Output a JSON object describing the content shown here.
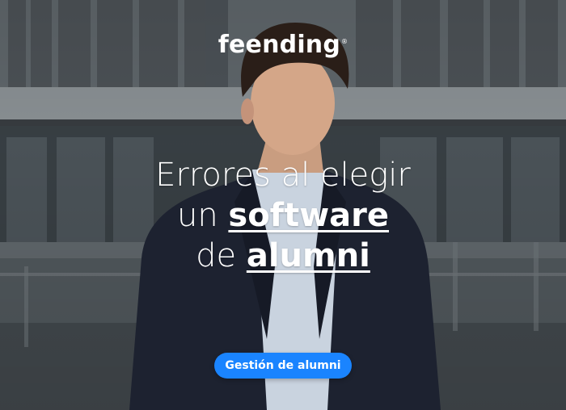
{
  "brand": {
    "name": "feending",
    "reg_mark": "®"
  },
  "headline": {
    "line1": "Errores al elegir",
    "line2_prefix": "un ",
    "line2_emphasis": "software",
    "line3_prefix": "de ",
    "line3_emphasis": "alumni"
  },
  "cta": {
    "label": "Gestión de alumni"
  },
  "colors": {
    "accent": "#1a84ff",
    "text": "#ffffff"
  }
}
